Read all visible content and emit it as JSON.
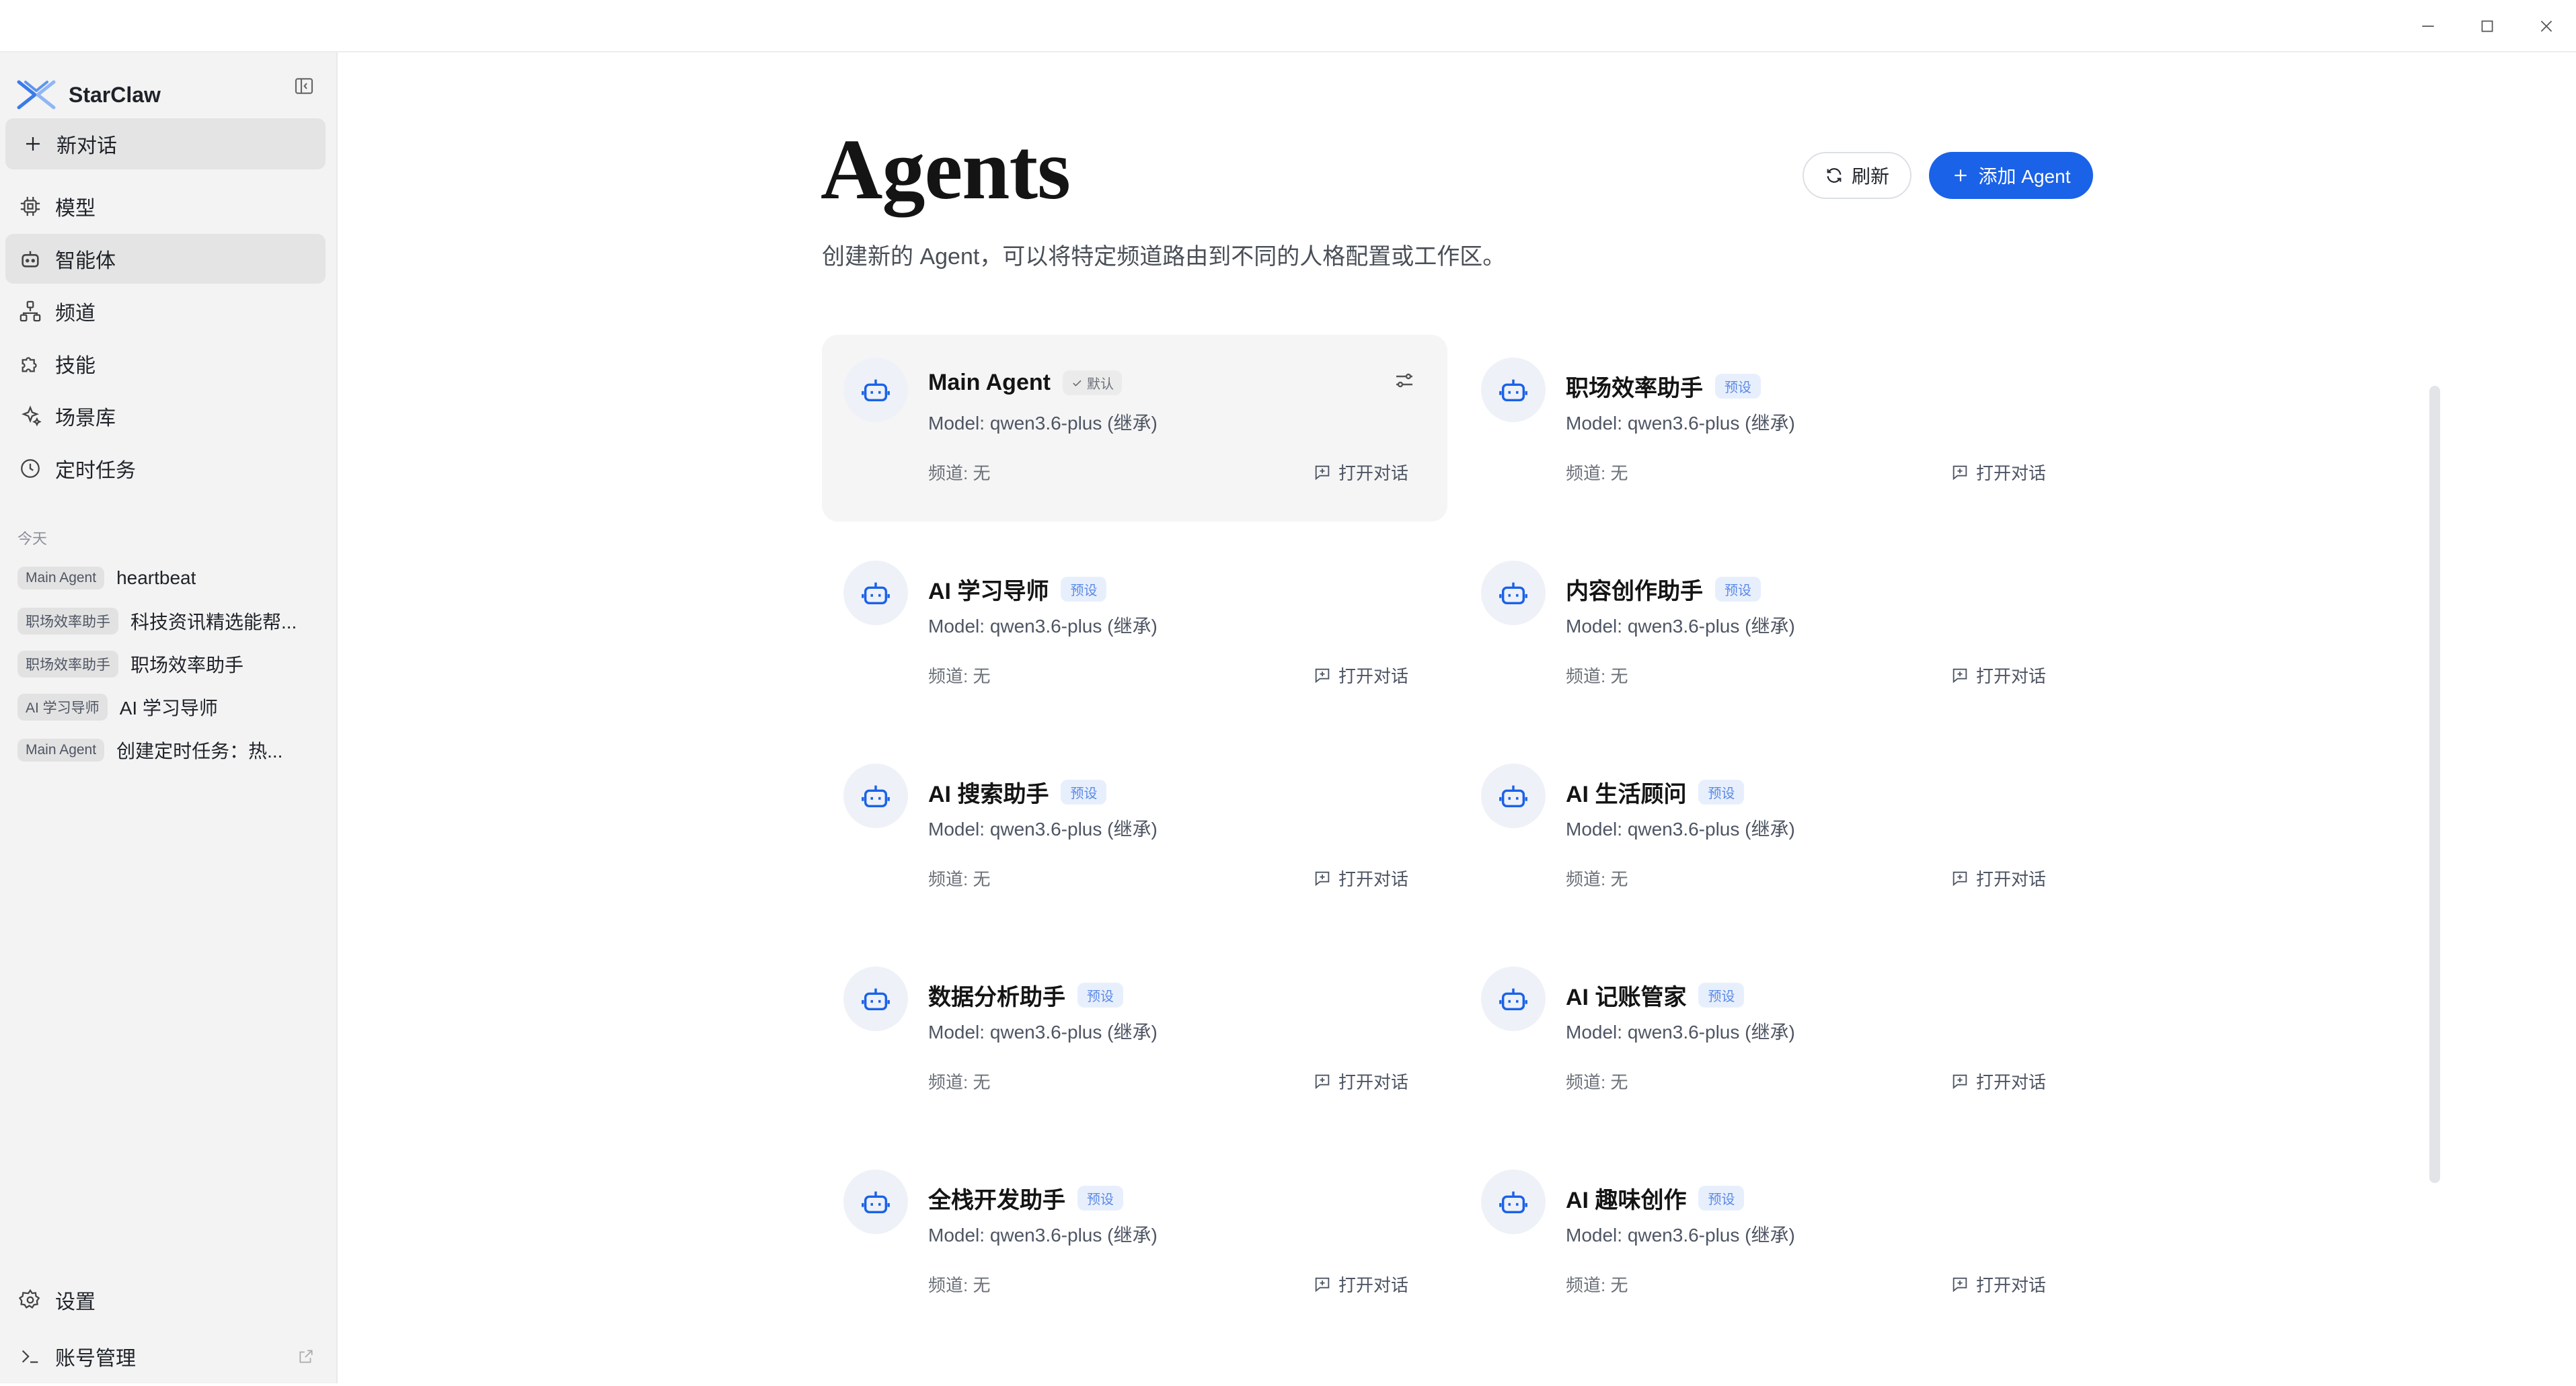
{
  "window": {
    "controls": [
      "minimize-icon",
      "maximize-icon",
      "close-icon"
    ]
  },
  "sidebar": {
    "brand": "StarClaw",
    "new_chat": "新对话",
    "nav": [
      {
        "label": "模型",
        "icon": "chip-icon"
      },
      {
        "label": "智能体",
        "icon": "robot-icon",
        "active": true
      },
      {
        "label": "频道",
        "icon": "network-icon"
      },
      {
        "label": "技能",
        "icon": "puzzle-icon"
      },
      {
        "label": "场景库",
        "icon": "sparkle-icon"
      },
      {
        "label": "定时任务",
        "icon": "clock-icon"
      }
    ],
    "history_label": "今天",
    "history": [
      {
        "tag": "Main Agent",
        "title": "heartbeat"
      },
      {
        "tag": "职场效率助手",
        "title": "科技资讯精选能帮..."
      },
      {
        "tag": "职场效率助手",
        "title": "职场效率助手"
      },
      {
        "tag": "AI 学习导师",
        "title": "AI 学习导师"
      },
      {
        "tag": "Main Agent",
        "title": "创建定时任务：热..."
      }
    ],
    "settings": "设置",
    "account": "账号管理"
  },
  "main": {
    "title": "Agents",
    "description": "创建新的 Agent，可以将特定频道路由到不同的人格配置或工作区。",
    "refresh_label": "刷新",
    "add_label": "添加 Agent",
    "agents": [
      {
        "name": "Main Agent",
        "badge": "默认",
        "model": "Model: qwen3.6-plus (继承)",
        "channel": "频道: 无",
        "open": "打开对话"
      },
      {
        "name": "职场效率助手",
        "badge": "预设",
        "model": "Model: qwen3.6-plus (继承)",
        "channel": "频道: 无",
        "open": "打开对话"
      },
      {
        "name": "AI 学习导师",
        "badge": "预设",
        "model": "Model: qwen3.6-plus (继承)",
        "channel": "频道: 无",
        "open": "打开对话"
      },
      {
        "name": "内容创作助手",
        "badge": "预设",
        "model": "Model: qwen3.6-plus (继承)",
        "channel": "频道: 无",
        "open": "打开对话"
      },
      {
        "name": "AI 搜索助手",
        "badge": "预设",
        "model": "Model: qwen3.6-plus (继承)",
        "channel": "频道: 无",
        "open": "打开对话"
      },
      {
        "name": "AI 生活顾问",
        "badge": "预设",
        "model": "Model: qwen3.6-plus (继承)",
        "channel": "频道: 无",
        "open": "打开对话"
      },
      {
        "name": "数据分析助手",
        "badge": "预设",
        "model": "Model: qwen3.6-plus (继承)",
        "channel": "频道: 无",
        "open": "打开对话"
      },
      {
        "name": "AI 记账管家",
        "badge": "预设",
        "model": "Model: qwen3.6-plus (继承)",
        "channel": "频道: 无",
        "open": "打开对话"
      },
      {
        "name": "全栈开发助手",
        "badge": "预设",
        "model": "Model: qwen3.6-plus (继承)",
        "channel": "频道: 无",
        "open": "打开对话"
      },
      {
        "name": "AI 趣味创作",
        "badge": "预设",
        "model": "Model: qwen3.6-plus (继承)",
        "channel": "频道: 无",
        "open": "打开对话"
      }
    ]
  },
  "colors": {
    "accent": "#1a62e8",
    "sidebar_bg": "#f3f3f3",
    "preset_badge": "#e8effc"
  }
}
